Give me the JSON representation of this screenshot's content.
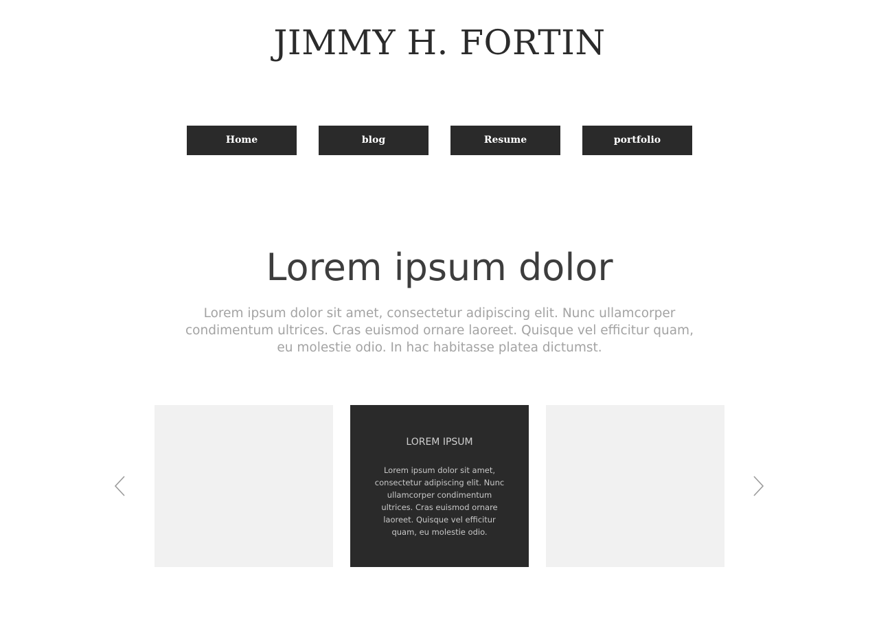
{
  "header": {
    "site_title": "JIMMY H. FORTIN"
  },
  "nav": {
    "items": [
      {
        "label": "Home"
      },
      {
        "label": "blog"
      },
      {
        "label": "Resume"
      },
      {
        "label": "portfolio"
      }
    ]
  },
  "hero": {
    "heading": "Lorem ipsum dolor",
    "text": "Lorem ipsum dolor sit amet, consectetur adipiscing elit. Nunc ullamcorper condimentum ultrices. Cras euismod ornare laoreet. Quisque vel efficitur quam, eu molestie odio. In hac habitasse platea dictumst."
  },
  "carousel": {
    "prev_icon": "chevron-left-icon",
    "next_icon": "chevron-right-icon",
    "active_card": {
      "title": "LOREM IPSUM",
      "text": "Lorem ipsum dolor sit amet, consectetur adipiscing elit. Nunc ullamcorper condimentum ultrices. Cras euismod ornare laoreet. Quisque vel efficitur quam, eu molestie odio."
    }
  },
  "colors": {
    "dark": "#2a2a2a",
    "card_light": "#f1f1f1",
    "body_text": "#a3a3a3",
    "heading_text": "#3d3d3d"
  }
}
